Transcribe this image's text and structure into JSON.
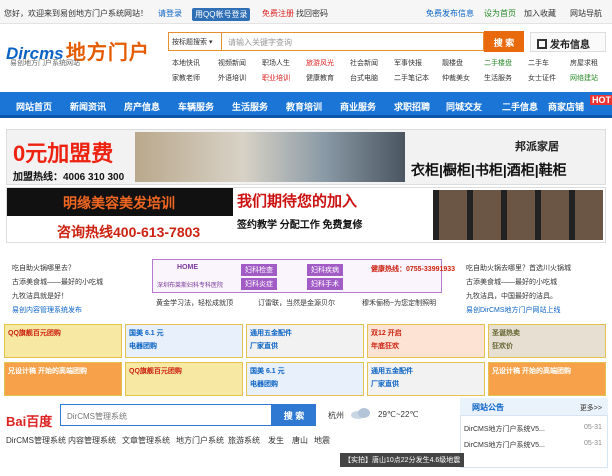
{
  "topbar": {
    "welcome": "您好，欢迎来到易创地方门户系统网站！",
    "login": "请登录",
    "qq_login": "用QQ帐号登录",
    "register": "免费注册",
    "find_password": "找回密码",
    "free_post": "免费发布信息",
    "set_home": "设为首页",
    "favorite": "加入收藏",
    "nav": "网站导航"
  },
  "header": {
    "logo_en": "Dircms",
    "logo_cn": "地方门户",
    "logo_sub": "易创地方门户系统网站",
    "search_category": "按标题搜索",
    "search_placeholder": "请输入关键字查询",
    "search_button": "搜 索",
    "post_button": "发布信息",
    "links_row1": [
      "本地快讯",
      "视频新闻",
      "职场人生",
      "旅游风光",
      "社会新闻",
      "军事快报",
      "靓楼盘",
      "二手楼盘",
      "二手车",
      "房屋求租"
    ],
    "links_row2": [
      "家教老师",
      "外语培训",
      "职业培训",
      "健康教育",
      "台式电脑",
      "二手笔记本",
      "仲裁美女",
      "生活服务",
      "女士证件",
      "网络建站"
    ]
  },
  "colors": {
    "nav_bg": "#1a75d6",
    "accent": "#e96a0d",
    "link_red": "#d22",
    "link_green": "#2a8a2a"
  },
  "nav": {
    "items": [
      "网站首页",
      "新闻资讯",
      "房产信息",
      "车辆服务",
      "生活服务",
      "教育培训",
      "商业服务",
      "求职招聘",
      "同城交友",
      "二手信息",
      "商家店铺"
    ],
    "hot_label": "HOT"
  },
  "ads": {
    "join_fee": "0元加盟费",
    "join_hotline": "加盟热线：4006 310 300",
    "brand": "邦派家居",
    "products": "衣柜|橱柜|书柜|酒柜|鞋柜",
    "beauty": "明缘美容美发培训",
    "hotline": "咨询热线400-613-7803",
    "join_us": "我们期待您的加入",
    "sign_teach": "签约教学 分配工作 免费复修"
  },
  "info": {
    "left": [
      "吃自助火锅哪里去？",
      "古添美食城——最好的小吃城",
      "九牧洁具就是好！",
      "易创内容管理系统发布"
    ],
    "right": [
      "吃自助火锅去哪里？首选川火锅城",
      "古添美食城——最好的小吃城",
      "九牧洁具，中国最好的洁具。",
      "易创DirCMS地方门户网站上线"
    ],
    "hospital_home": "HOME",
    "hospital_name": "深圳布莱斯妇科专科医院",
    "hospital_tags": [
      "妇科检查",
      "妇科疾病",
      "妇科炎症",
      "妇科手术"
    ],
    "health_hotline": "健康热线：0755-33991933",
    "sub_links": [
      "黄金学习法，轻松成就顶",
      "订雷联，当然是金源贝尔",
      "穆禾俪杨~为您定制照明"
    ]
  },
  "thumbs": [
    {
      "text": "QQ旗舰百元团购",
      "sub": ""
    },
    {
      "text": "国美 6.1 元",
      "sub": "电器团购"
    },
    {
      "text": "通用五金配件",
      "sub": "厂家直供"
    },
    {
      "text": "双12 开启",
      "sub": "年底狂欢"
    },
    {
      "text": "圣诞热卖",
      "sub": "狂欢价"
    },
    {
      "text": "兄设计稿 开始的高端团购",
      "sub": ""
    },
    {
      "text": "QQ旗舰百元团购",
      "sub": ""
    },
    {
      "text": "国美 6.1 元",
      "sub": "电器团购"
    },
    {
      "text": "通用五金配件",
      "sub": "厂家直供"
    },
    {
      "text": "兄设计稿 开始的高端团购",
      "sub": ""
    }
  ],
  "bottom": {
    "baidu_logo": "Bai百度",
    "baidu_search_value": "DirCMS管理系统",
    "baidu_button": "搜 索",
    "city": "杭州",
    "temperature": "29℃~22℃",
    "links": [
      "DirCMS管理系统",
      "内容管理系统",
      "文章管理系统",
      "地方门户系统",
      "旅游系统",
      "发生",
      "唐山",
      "地震"
    ],
    "notice_title": "网站公告",
    "notice_more": "更多>>",
    "notices": [
      {
        "title": "DirCMS地方门户系统V5...",
        "date": "05-31"
      },
      {
        "title": "DirCMS地方门户系统V5...",
        "date": "05-31"
      }
    ],
    "flash": "【实拍】唐山10点22分发生4.6级地震"
  }
}
